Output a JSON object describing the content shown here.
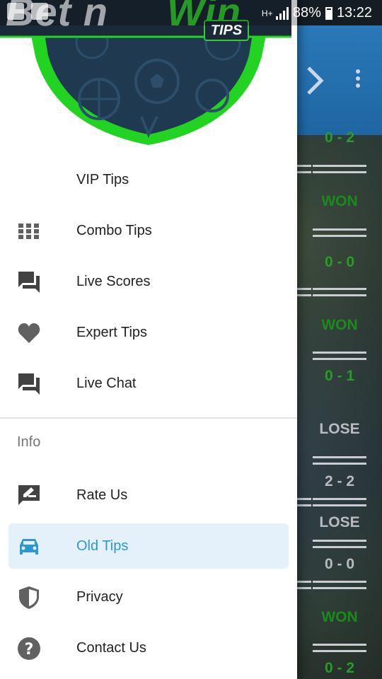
{
  "status_bar": {
    "network_label": "H+",
    "battery_percent": "88%",
    "time": "13:22"
  },
  "header": {
    "logo_text_left": "Bet n",
    "logo_text_right": "Win",
    "logo_badge": "TIPS"
  },
  "drawer": {
    "items": [
      {
        "label": "VIP Tips",
        "icon": "none"
      },
      {
        "label": "Combo Tips",
        "icon": "grid-icon"
      },
      {
        "label": "Live Scores",
        "icon": "forum-icon"
      },
      {
        "label": "Expert Tips",
        "icon": "heart-icon"
      },
      {
        "label": "Live Chat",
        "icon": "forum-icon"
      }
    ],
    "section_title": "Info",
    "info_items": [
      {
        "label": "Rate Us",
        "icon": "rate-review-icon"
      },
      {
        "label": "Old Tips",
        "icon": "car-icon",
        "selected": true
      },
      {
        "label": "Privacy",
        "icon": "shield-icon"
      },
      {
        "label": "Contact Us",
        "icon": "help-icon"
      }
    ]
  },
  "background_results": [
    {
      "text": "0 - 2",
      "kind": "score"
    },
    {
      "text": "WON",
      "kind": "won"
    },
    {
      "text": "0 - 0",
      "kind": "score"
    },
    {
      "text": "WON",
      "kind": "won"
    },
    {
      "text": "0 - 1",
      "kind": "score"
    },
    {
      "text": "LOSE",
      "kind": "lose"
    },
    {
      "text": "2 - 2",
      "kind": "score-grey"
    },
    {
      "text": "LOSE",
      "kind": "lose"
    },
    {
      "text": "0 - 0",
      "kind": "score-grey"
    },
    {
      "text": "WON",
      "kind": "won"
    },
    {
      "text": "0 - 2",
      "kind": "score"
    }
  ],
  "colors": {
    "accent": "#2b97d6",
    "selected_bg": "#e4f0fa",
    "logo_green": "#33cc33",
    "won_green": "#1a8a1a",
    "toolbar_blue": "#2a78b8"
  }
}
